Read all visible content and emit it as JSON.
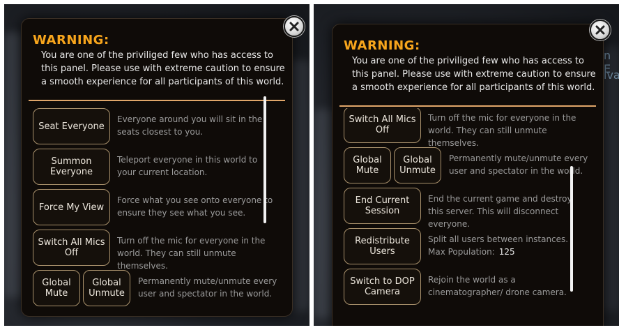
{
  "close_icon": "close-x-icon",
  "colors": {
    "warning": "#f7a51c",
    "divider": "#e0a66a",
    "button_border": "#a9916c",
    "description": "#9b9b9b"
  },
  "left": {
    "warning_title": "WARNING:",
    "warning_text": "You are one of the priviliged few who has access to this panel. Please use with extreme caution to ensure a smooth experience for all participants of this world.",
    "rows": [
      {
        "buttons": [
          "Seat Everyone"
        ],
        "description": "Everyone around you will sit in the seats closest to you."
      },
      {
        "buttons": [
          "Summon Everyone"
        ],
        "description": "Teleport everyone in this world to your current location."
      },
      {
        "buttons": [
          "Force My View"
        ],
        "description": "Force what you see onto everyone to ensure they see what you see."
      },
      {
        "buttons": [
          "Switch All Mics Off"
        ],
        "description": "Turn off the mic for everyone in the world. They can still unmute themselves."
      },
      {
        "buttons": [
          "Global Mute",
          "Global Unmute"
        ],
        "description": "Permanently mute/unmute every user and spectator in the world."
      }
    ]
  },
  "right": {
    "warning_title": "WARNING:",
    "warning_text": "You are one of the priviliged few who has access to this panel. Please use with extreme caution to ensure a smooth experience for all participants of this world.",
    "behind_text": [
      "n E",
      "ıva"
    ],
    "rows": [
      {
        "buttons": [
          "Switch All Mics Off"
        ],
        "description": "Turn off the mic for everyone in the world. They can still unmute themselves."
      },
      {
        "buttons": [
          "Global Mute",
          "Global Unmute"
        ],
        "description": "Permanently mute/unmute every user and spectator in the world."
      },
      {
        "buttons": [
          "End Current Session"
        ],
        "description": "End the current game and destroy this server. This will disconnect everyone."
      },
      {
        "buttons": [
          "Redistribute Users"
        ],
        "description": "Split all users between instances.",
        "max_population_label": "Max Population:",
        "max_population_value": "125"
      },
      {
        "buttons": [
          "Switch to DOP Camera"
        ],
        "description": "Rejoin the world as a cinematographer/ drone camera."
      }
    ]
  }
}
